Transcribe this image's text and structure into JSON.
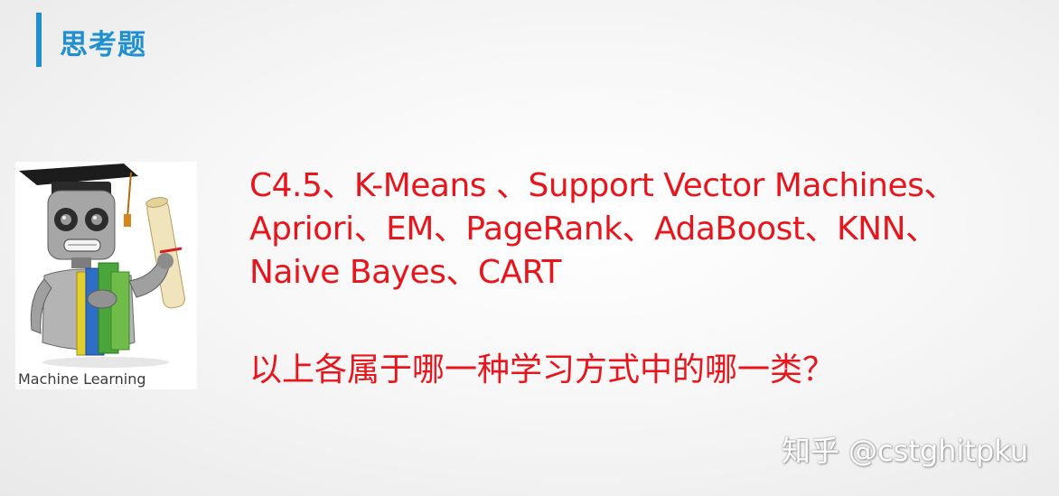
{
  "slide": {
    "title": "思考题"
  },
  "figure": {
    "caption": "Machine Learning"
  },
  "content": {
    "algorithm_lines": [
      "C4.5、K-Means 、Support Vector Machines、",
      "Apriori、EM、PageRank、AdaBoost、KNN、",
      "Naive Bayes、CART"
    ],
    "question": "以上各属于哪一种学习方式中的哪一类？"
  },
  "watermark": {
    "text": "知乎 @cstghitpku"
  },
  "colors": {
    "accent": "#1f8fd0",
    "body_text": "#e8161c",
    "background": "#f4f4f4"
  }
}
